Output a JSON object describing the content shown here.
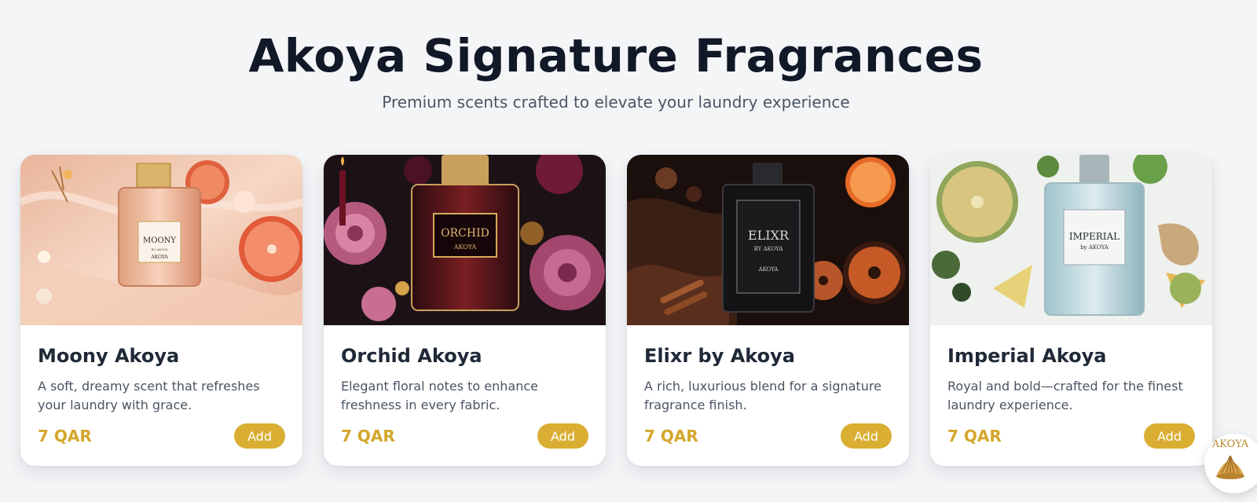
{
  "header": {
    "title": "Akoya Signature Fragrances",
    "subtitle": "Premium scents crafted to elevate your laundry experience"
  },
  "products": [
    {
      "name": "Moony Akoya",
      "description": "A soft, dreamy scent that refreshes your laundry with grace.",
      "price": "7 QAR",
      "add_label": "Add",
      "bottle_label_line1": "MOONY",
      "bottle_label_line2": "BY AKOYA",
      "bottle_label_line3": "AKOYA"
    },
    {
      "name": "Orchid Akoya",
      "description": "Elegant floral notes to enhance freshness in every fabric.",
      "price": "7 QAR",
      "add_label": "Add",
      "bottle_label_line1": "ORCHID",
      "bottle_label_line2": "AKOYA"
    },
    {
      "name": "Elixr by Akoya",
      "description": "A rich, luxurious blend for a signature fragrance finish.",
      "price": "7 QAR",
      "add_label": "Add",
      "bottle_label_line1": "ELIXR",
      "bottle_label_line2": "BY AKOYA",
      "bottle_label_line3": "AKOYA"
    },
    {
      "name": "Imperial Akoya",
      "description": "Royal and bold—crafted for the finest laundry experience.",
      "price": "7 QAR",
      "add_label": "Add",
      "bottle_label_line1": "IMPERIAL",
      "bottle_label_line2": "by AKOYA"
    }
  ],
  "brand_badge": {
    "text": "AKOYA",
    "icon": "shell-icon"
  },
  "colors": {
    "accent": "#d9ae32",
    "price": "#d4a62a",
    "background": "#f3f5f7",
    "title": "#111827"
  }
}
